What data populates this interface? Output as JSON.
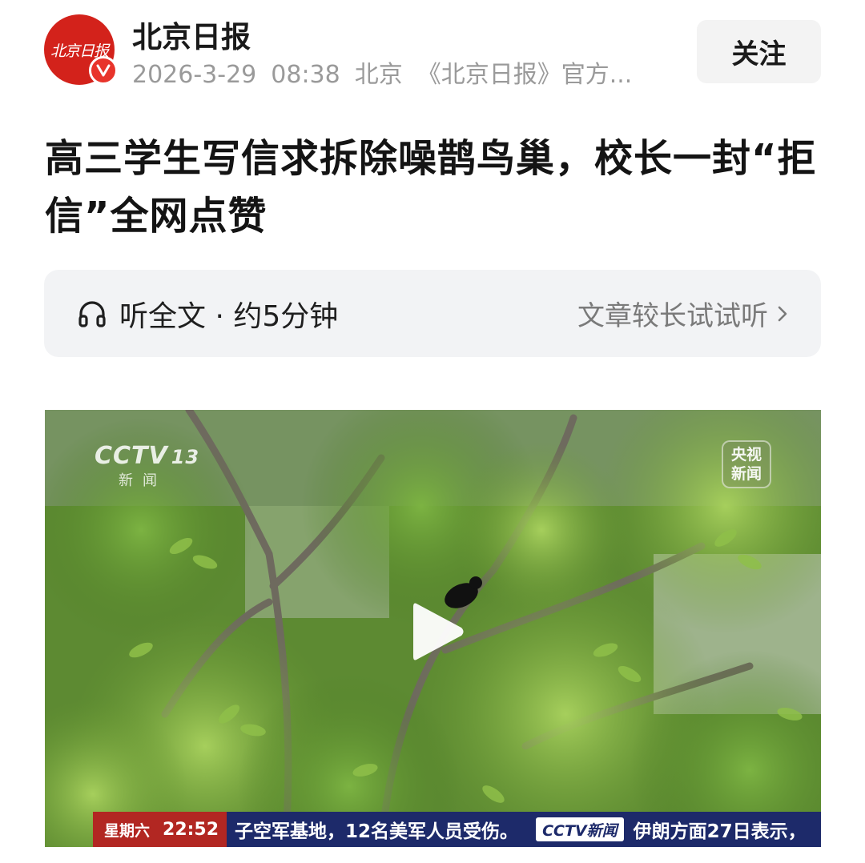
{
  "header": {
    "avatar_text": "北京日报",
    "author": "北京日报",
    "date": "2026-3-29",
    "time": "08:38",
    "location": "北京",
    "desc": "《北京日报》官方...",
    "follow_label": "关注"
  },
  "article": {
    "title": "高三学生写信求拆除噪鹊鸟巢，校长一封“拒信”全网点赞"
  },
  "listen": {
    "label": "听全文 · 约5分钟",
    "hint": "文章较长试试听"
  },
  "video": {
    "channel_logo": "CCTV",
    "channel_num": "13",
    "channel_sub": "新闻",
    "watermark_line1": "央视",
    "watermark_line2": "新闻",
    "ticker_day": "星期六",
    "ticker_time": "22:52",
    "ticker_text": "子空军基地，12名美军人员受伤。",
    "ticker_logo": "CCTV新闻",
    "ticker_text2": "伊朗方面27日表示，"
  },
  "colors": {
    "brand_red": "#d3221b",
    "ticker_blue": "#1d2a6a",
    "ticker_red": "#b22722"
  }
}
